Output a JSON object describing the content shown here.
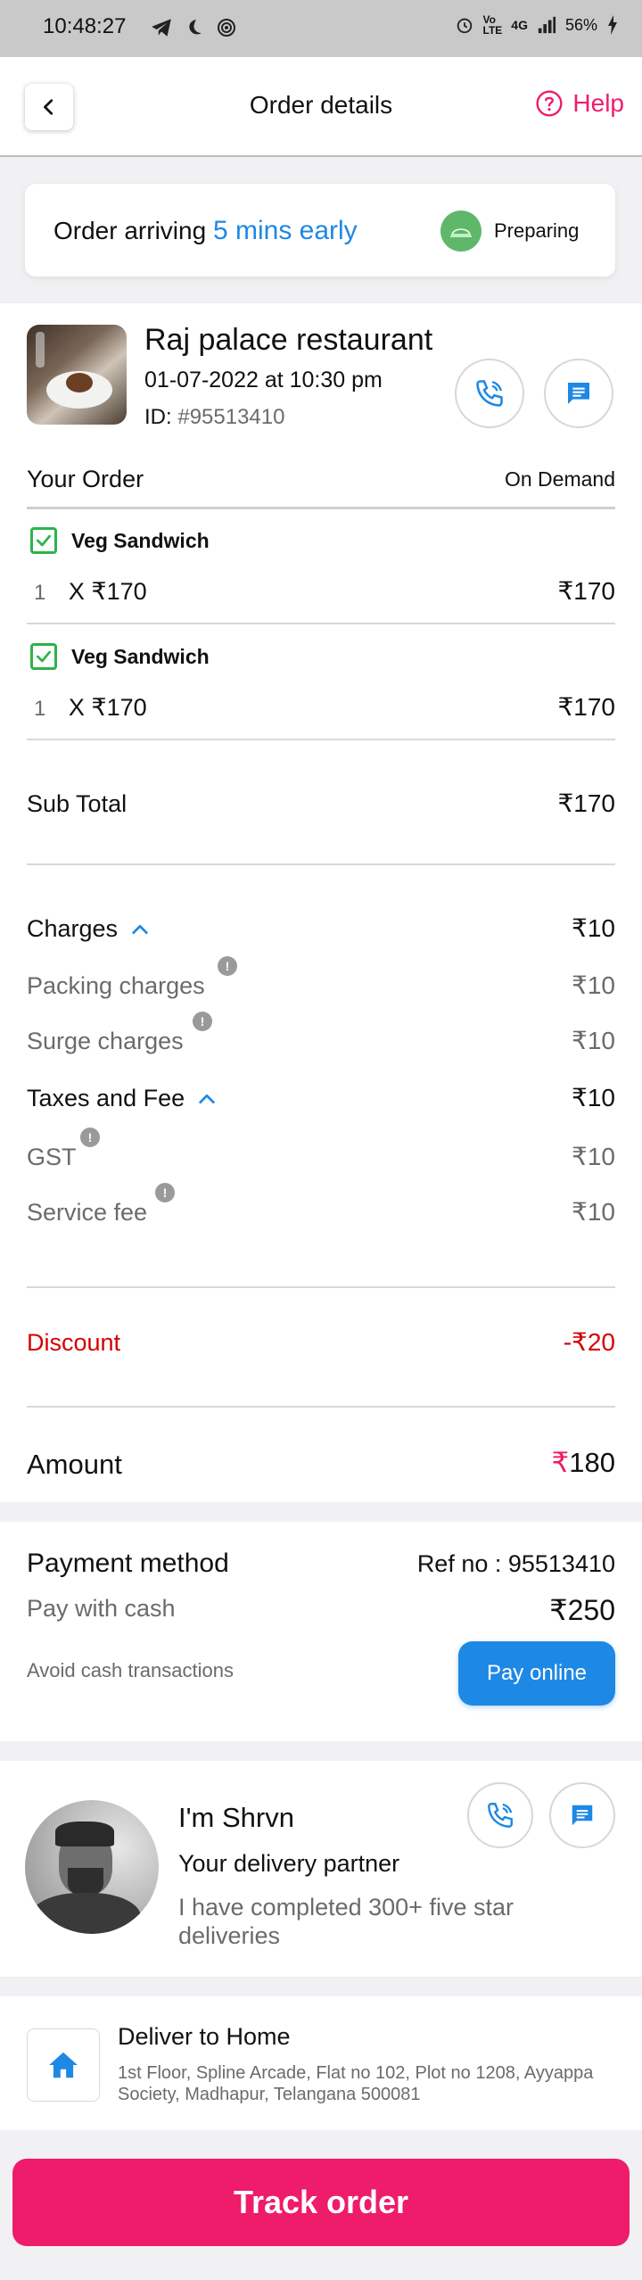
{
  "status_bar": {
    "time": "10:48:27",
    "battery": "56%",
    "network": "4G"
  },
  "header": {
    "title": "Order details",
    "help_label": "Help"
  },
  "arrival": {
    "prefix": "Order arriving",
    "highlight": "5 mins early",
    "status": "Preparing"
  },
  "restaurant": {
    "name": "Raj palace restaurant",
    "datetime": "01-07-2022 at 10:30 pm",
    "id_label": "ID:",
    "id_value": "#95513410"
  },
  "order": {
    "heading": "Your Order",
    "mode": "On Demand",
    "items": [
      {
        "name": "Veg Sandwich",
        "qty": "1",
        "x": "X",
        "unit_price": "₹170",
        "total": "₹170"
      },
      {
        "name": "Veg Sandwich",
        "qty": "1",
        "x": "X",
        "unit_price": "₹170",
        "total": "₹170"
      }
    ],
    "subtotal_label": "Sub Total",
    "subtotal_value": "₹170"
  },
  "charges": {
    "label": "Charges",
    "value": "₹10",
    "packing_label": "Packing charges",
    "packing_value": "₹10",
    "surge_label": "Surge charges",
    "surge_value": "₹10"
  },
  "taxes": {
    "label": "Taxes and Fee",
    "value": "₹10",
    "gst_label": "GST",
    "gst_value": "₹10",
    "service_label": "Service fee",
    "service_value": "₹10"
  },
  "discount": {
    "label": "Discount",
    "value": "-₹20"
  },
  "amount": {
    "label": "Amount",
    "currency": "₹",
    "value": "180"
  },
  "payment": {
    "title": "Payment method",
    "ref": "Ref no : 95513410",
    "method": "Pay with cash",
    "value": "₹250",
    "note": "Avoid cash transactions",
    "button": "Pay online"
  },
  "partner": {
    "name": "I'm Shrvn",
    "role": "Your delivery partner",
    "bio": "I have completed 300+ five star deliveries"
  },
  "delivery": {
    "title": "Deliver to Home",
    "address": "1st Floor, Spline Arcade, Flat no 102, Plot no 1208, Ayyappa Society, Madhapur, Telangana 500081"
  },
  "track_button": "Track order",
  "colors": {
    "pink": "#ee1c6a",
    "blue": "#1e88e5",
    "green": "#2db34a",
    "red": "#d50000"
  }
}
